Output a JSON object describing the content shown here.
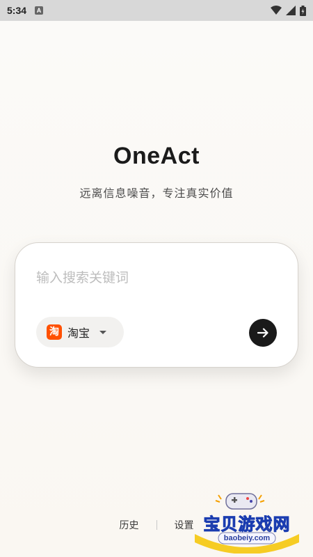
{
  "status_bar": {
    "time": "5:34",
    "notification_icon": "a-icon",
    "icons": [
      "wifi-icon",
      "signal-icon",
      "battery-icon"
    ]
  },
  "app": {
    "title": "OneAct",
    "subtitle": "远离信息噪音，专注真实价值"
  },
  "search": {
    "placeholder": "输入搜索关键词",
    "value": "",
    "source": {
      "label": "淘宝",
      "icon": "taobao-icon",
      "icon_char": "淘"
    },
    "submit_icon": "arrow-right-icon"
  },
  "bottom_nav": {
    "history_label": "历史",
    "settings_label": "设置"
  },
  "watermark": {
    "text": "宝贝游戏网",
    "url": "baobeiy.com"
  },
  "colors": {
    "accent": "#1a1a1a",
    "taobao": "#ff5000",
    "background": "#faf7f2"
  }
}
